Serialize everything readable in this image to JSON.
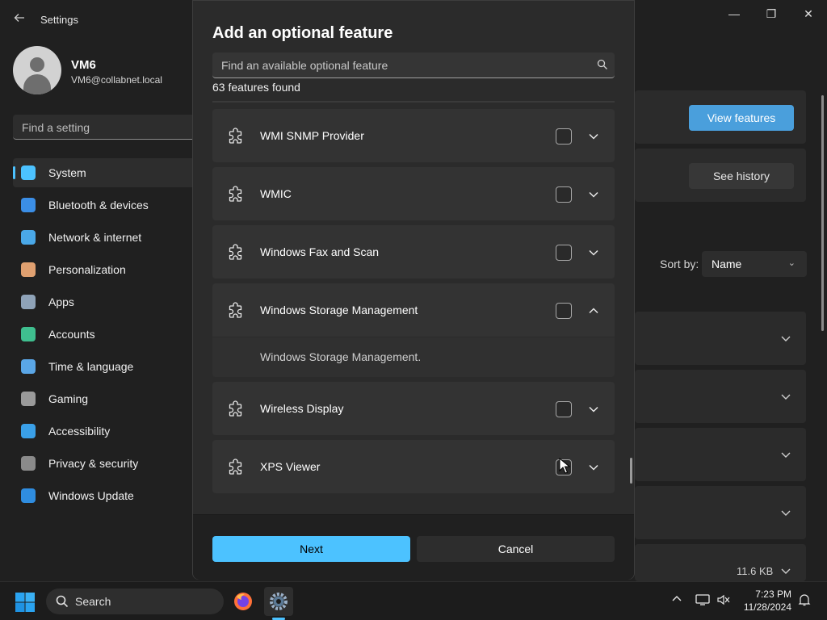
{
  "window": {
    "title": "Settings",
    "back_icon": "back-arrow-icon",
    "controls": {
      "minimize": "—",
      "maximize": "❐",
      "close": "✕"
    }
  },
  "profile": {
    "name": "VM6",
    "email": "VM6@collabnet.local"
  },
  "search": {
    "placeholder": "Find a setting"
  },
  "sidebar": {
    "items": [
      {
        "label": "System",
        "icon": "system-icon",
        "color": "#4cc2ff",
        "active": true
      },
      {
        "label": "Bluetooth & devices",
        "icon": "bluetooth-icon",
        "color": "#3b8ee6"
      },
      {
        "label": "Network & internet",
        "icon": "wifi-icon",
        "color": "#4aa8e8"
      },
      {
        "label": "Personalization",
        "icon": "brush-icon",
        "color": "#e0a070"
      },
      {
        "label": "Apps",
        "icon": "apps-icon",
        "color": "#8fa3b8"
      },
      {
        "label": "Accounts",
        "icon": "accounts-icon",
        "color": "#3fbf8f"
      },
      {
        "label": "Time & language",
        "icon": "globe-clock-icon",
        "color": "#5aa6e6"
      },
      {
        "label": "Gaming",
        "icon": "gamepad-icon",
        "color": "#9a9a9a"
      },
      {
        "label": "Accessibility",
        "icon": "accessibility-icon",
        "color": "#3aa0e8"
      },
      {
        "label": "Privacy & security",
        "icon": "shield-icon",
        "color": "#8a8a8a"
      },
      {
        "label": "Windows Update",
        "icon": "update-icon",
        "color": "#2f8de0"
      }
    ]
  },
  "background_panel": {
    "view_features_label": "View features",
    "see_history_label": "See history",
    "sort_by_label": "Sort by:",
    "sort_by_value": "Name",
    "size_text": "11.6 KB"
  },
  "dialog": {
    "title": "Add an optional feature",
    "search_placeholder": "Find an available optional feature",
    "found_count": "63 features found",
    "features": [
      {
        "name": "WMI SNMP Provider",
        "checked": false,
        "expanded": false
      },
      {
        "name": "WMIC",
        "checked": false,
        "expanded": false
      },
      {
        "name": "Windows Fax and Scan",
        "checked": false,
        "expanded": false
      },
      {
        "name": "Windows Storage Management",
        "checked": false,
        "expanded": true,
        "description": "Windows Storage Management."
      },
      {
        "name": "Wireless Display",
        "checked": false,
        "expanded": false
      },
      {
        "name": "XPS Viewer",
        "checked": false,
        "expanded": false
      }
    ],
    "next_label": "Next",
    "cancel_label": "Cancel"
  },
  "taskbar": {
    "search_label": "Search",
    "apps": [
      "firefox-icon",
      "settings-gear-icon"
    ],
    "time": "7:23 PM",
    "date": "11/28/2024"
  },
  "colors": {
    "accent": "#4cc2ff",
    "background": "#202020",
    "dialog": "#2b2b2b",
    "card": "#333333"
  }
}
